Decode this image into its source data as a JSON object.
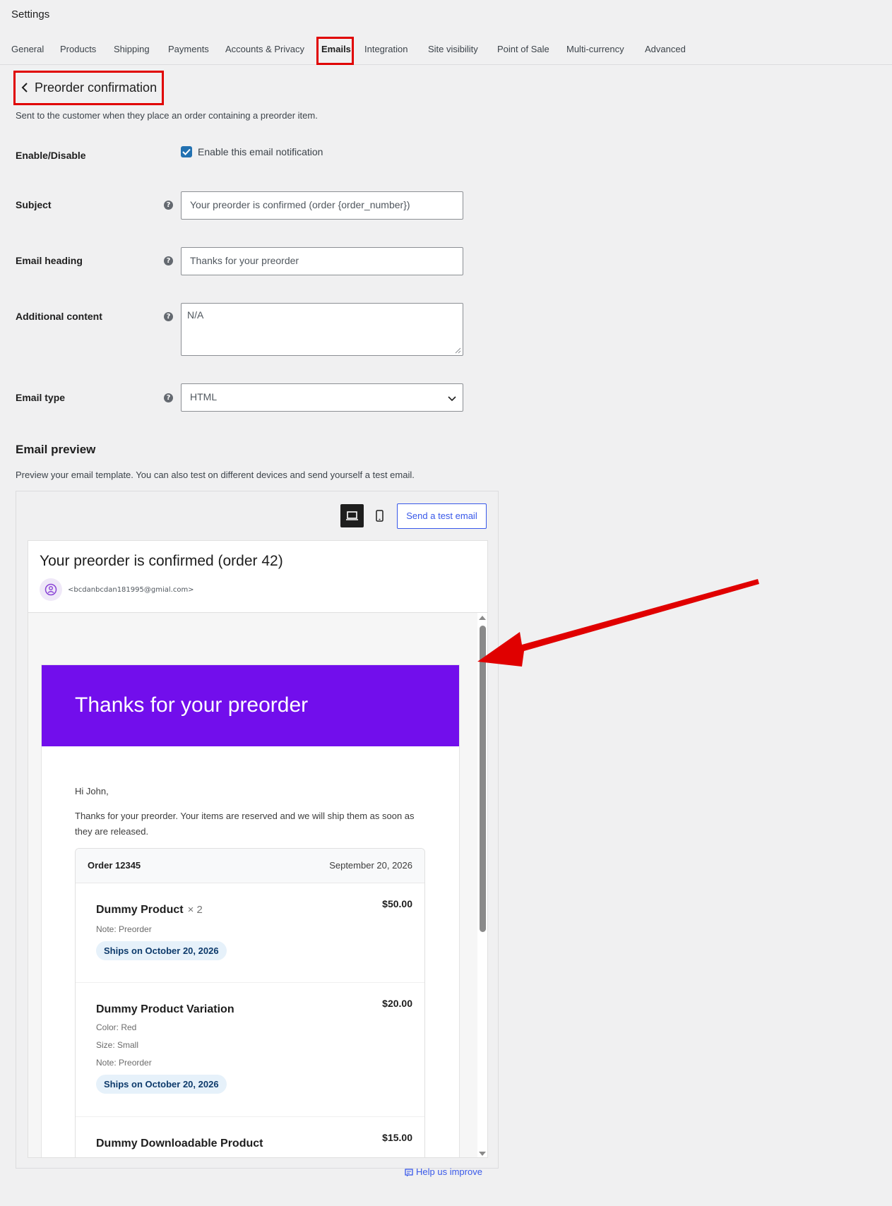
{
  "page": {
    "title": "Settings"
  },
  "tabs": [
    {
      "label": "General",
      "active": false
    },
    {
      "label": "Products",
      "active": false
    },
    {
      "label": "Shipping",
      "active": false
    },
    {
      "label": "Payments",
      "active": false
    },
    {
      "label": "Accounts & Privacy",
      "active": false
    },
    {
      "label": "Emails",
      "active": true
    },
    {
      "label": "Integration",
      "active": false
    },
    {
      "label": "Site visibility",
      "active": false
    },
    {
      "label": "Point of Sale",
      "active": false
    },
    {
      "label": "Multi-currency",
      "active": false
    },
    {
      "label": "Advanced",
      "active": false
    }
  ],
  "email_settings": {
    "title": "Preorder confirmation",
    "description": "Sent to the customer when they place an order containing a preorder item.",
    "enable": {
      "label": "Enable/Disable",
      "checkbox_label": "Enable this email notification",
      "checked": true
    },
    "subject": {
      "label": "Subject",
      "placeholder": "Your preorder is confirmed (order {order_number})",
      "value": ""
    },
    "heading": {
      "label": "Email heading",
      "placeholder": "Thanks for your preorder",
      "value": ""
    },
    "additional": {
      "label": "Additional content",
      "placeholder": "N/A",
      "value": ""
    },
    "type": {
      "label": "Email type",
      "value": "HTML"
    }
  },
  "preview": {
    "title": "Email preview",
    "description": "Preview your email template. You can also test on different devices and send yourself a test email.",
    "send_test_label": "Send a test email",
    "mail_subject": "Your preorder is confirmed (order 42)",
    "mail_from": "<bcdanbcdan181995@gmial.com>",
    "email": {
      "heading": "Thanks for your preorder",
      "greeting": "Hi John,",
      "intro": "Thanks for your preorder. Your items are reserved and we will ship them as soon as they are released.",
      "order_number": "Order 12345",
      "order_date": "September 20, 2026",
      "items": [
        {
          "name": "Dummy Product",
          "qty": "× 2",
          "price": "$50.00",
          "meta": [
            "Note: Preorder"
          ],
          "ships": "Ships on October 20, 2026"
        },
        {
          "name": "Dummy Product Variation",
          "qty": "",
          "price": "$20.00",
          "meta": [
            "Color: Red",
            "Size: Small",
            "Note: Preorder"
          ],
          "ships": "Ships on October 20, 2026"
        },
        {
          "name": "Dummy Downloadable Product",
          "qty": "",
          "price": "$15.00",
          "meta": [],
          "ships": ""
        }
      ]
    }
  },
  "footer": {
    "help_label": "Help us improve"
  },
  "colors": {
    "accent": "#3858e9",
    "email_brand": "#720eec",
    "highlight": "#e00000"
  }
}
